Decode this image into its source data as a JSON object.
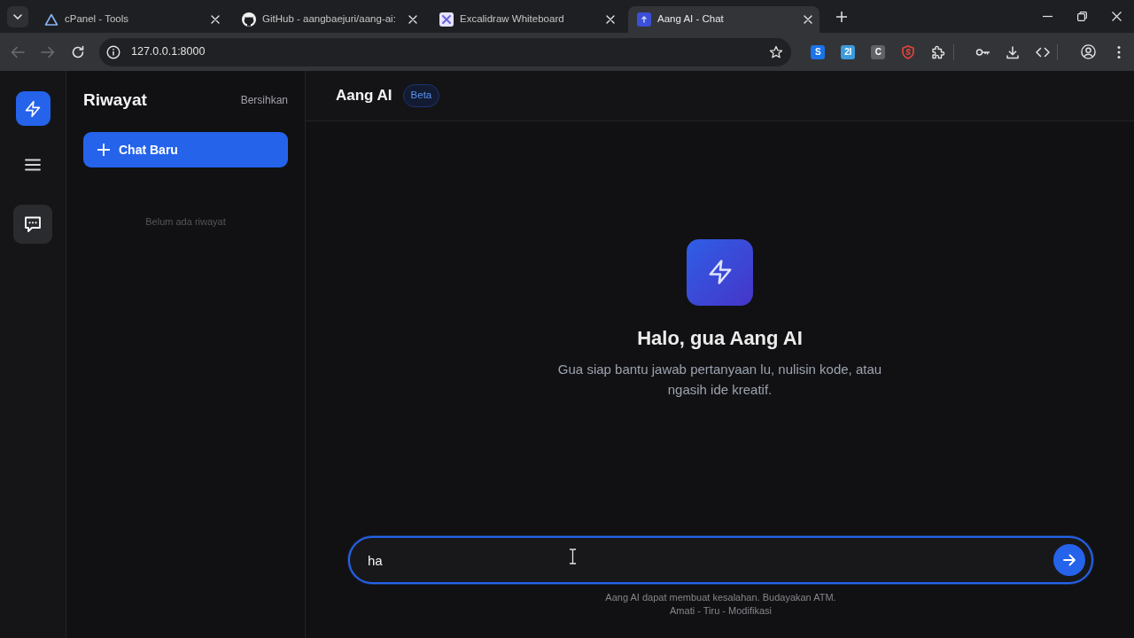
{
  "browser": {
    "tabs": [
      {
        "kind": "cpanel",
        "title": "cPanel - Tools",
        "selected": false
      },
      {
        "kind": "github",
        "title": "GitHub - aangbaejuri/aang-ai:",
        "selected": false
      },
      {
        "kind": "excalidraw",
        "title": "Excalidraw Whiteboard",
        "selected": false
      },
      {
        "kind": "app",
        "title": "Aang AI - Chat",
        "selected": true
      }
    ],
    "nav": [
      {
        "kind": "back",
        "disabled": true
      },
      {
        "kind": "forward",
        "disabled": true
      },
      {
        "kind": "reload",
        "disabled": false
      }
    ],
    "address": "127.0.0.1:8000",
    "extensions": [
      {
        "kind": "letter",
        "label": "S",
        "color": "#1a73e8"
      },
      {
        "kind": "letter",
        "label": "2I",
        "color": "#3b9bdc"
      },
      {
        "kind": "letter",
        "label": "C",
        "color": "#5f6368"
      },
      {
        "kind": "shield",
        "color": "#e8453c"
      }
    ]
  },
  "rail": {
    "items": [
      {
        "kind": "menu",
        "selected": false
      },
      {
        "kind": "chat",
        "selected": true
      }
    ]
  },
  "sidebar": {
    "title": "Riwayat",
    "clear": "Bersihkan",
    "new_chat": "Chat Baru",
    "empty": "Belum ada riwayat"
  },
  "header": {
    "title": "Aang AI",
    "badge": "Beta"
  },
  "welcome": {
    "title": "Halo, gua Aang AI",
    "text": "Gua siap bantu jawab pertanyaan lu, nulisin kode, atau ngasih ide kreatif."
  },
  "composer": {
    "value": "ha",
    "focused": true
  },
  "footer": [
    "Aang AI dapat membuat kesalahan. Budayakan ATM.",
    "Amati - Tiru - Modifikasi"
  ]
}
